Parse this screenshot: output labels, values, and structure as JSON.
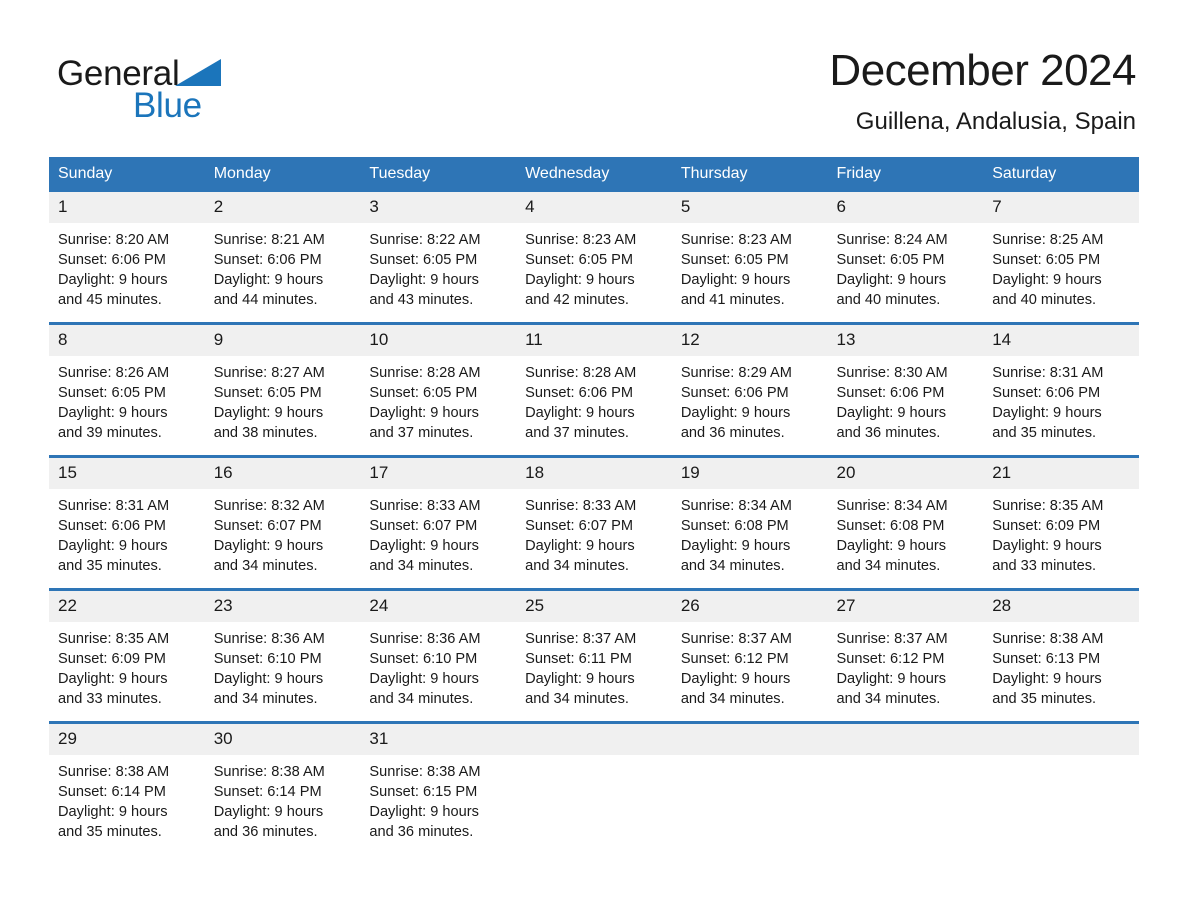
{
  "brand": {
    "name_part1": "General",
    "name_part2": "Blue",
    "triangle_color": "#1b75bb",
    "text_color": "#1a1a1a"
  },
  "header": {
    "title": "December 2024",
    "subtitle": "Guillena, Andalusia, Spain"
  },
  "theme": {
    "header_blue": "#2e75b6",
    "row_divider_blue": "#2e75b6",
    "daynum_band": "#f0f0f0",
    "page_background": "#ffffff"
  },
  "calendar": {
    "month": "December",
    "year": "2024",
    "location": "Guillena, Andalusia, Spain",
    "weekday_headers": [
      "Sunday",
      "Monday",
      "Tuesday",
      "Wednesday",
      "Thursday",
      "Friday",
      "Saturday"
    ],
    "weeks": [
      [
        {
          "day": "1",
          "sunrise": "Sunrise: 8:20 AM",
          "sunset": "Sunset: 6:06 PM",
          "daylight_line1": "Daylight: 9 hours",
          "daylight_line2": "and 45 minutes."
        },
        {
          "day": "2",
          "sunrise": "Sunrise: 8:21 AM",
          "sunset": "Sunset: 6:06 PM",
          "daylight_line1": "Daylight: 9 hours",
          "daylight_line2": "and 44 minutes."
        },
        {
          "day": "3",
          "sunrise": "Sunrise: 8:22 AM",
          "sunset": "Sunset: 6:05 PM",
          "daylight_line1": "Daylight: 9 hours",
          "daylight_line2": "and 43 minutes."
        },
        {
          "day": "4",
          "sunrise": "Sunrise: 8:23 AM",
          "sunset": "Sunset: 6:05 PM",
          "daylight_line1": "Daylight: 9 hours",
          "daylight_line2": "and 42 minutes."
        },
        {
          "day": "5",
          "sunrise": "Sunrise: 8:23 AM",
          "sunset": "Sunset: 6:05 PM",
          "daylight_line1": "Daylight: 9 hours",
          "daylight_line2": "and 41 minutes."
        },
        {
          "day": "6",
          "sunrise": "Sunrise: 8:24 AM",
          "sunset": "Sunset: 6:05 PM",
          "daylight_line1": "Daylight: 9 hours",
          "daylight_line2": "and 40 minutes."
        },
        {
          "day": "7",
          "sunrise": "Sunrise: 8:25 AM",
          "sunset": "Sunset: 6:05 PM",
          "daylight_line1": "Daylight: 9 hours",
          "daylight_line2": "and 40 minutes."
        }
      ],
      [
        {
          "day": "8",
          "sunrise": "Sunrise: 8:26 AM",
          "sunset": "Sunset: 6:05 PM",
          "daylight_line1": "Daylight: 9 hours",
          "daylight_line2": "and 39 minutes."
        },
        {
          "day": "9",
          "sunrise": "Sunrise: 8:27 AM",
          "sunset": "Sunset: 6:05 PM",
          "daylight_line1": "Daylight: 9 hours",
          "daylight_line2": "and 38 minutes."
        },
        {
          "day": "10",
          "sunrise": "Sunrise: 8:28 AM",
          "sunset": "Sunset: 6:05 PM",
          "daylight_line1": "Daylight: 9 hours",
          "daylight_line2": "and 37 minutes."
        },
        {
          "day": "11",
          "sunrise": "Sunrise: 8:28 AM",
          "sunset": "Sunset: 6:06 PM",
          "daylight_line1": "Daylight: 9 hours",
          "daylight_line2": "and 37 minutes."
        },
        {
          "day": "12",
          "sunrise": "Sunrise: 8:29 AM",
          "sunset": "Sunset: 6:06 PM",
          "daylight_line1": "Daylight: 9 hours",
          "daylight_line2": "and 36 minutes."
        },
        {
          "day": "13",
          "sunrise": "Sunrise: 8:30 AM",
          "sunset": "Sunset: 6:06 PM",
          "daylight_line1": "Daylight: 9 hours",
          "daylight_line2": "and 36 minutes."
        },
        {
          "day": "14",
          "sunrise": "Sunrise: 8:31 AM",
          "sunset": "Sunset: 6:06 PM",
          "daylight_line1": "Daylight: 9 hours",
          "daylight_line2": "and 35 minutes."
        }
      ],
      [
        {
          "day": "15",
          "sunrise": "Sunrise: 8:31 AM",
          "sunset": "Sunset: 6:06 PM",
          "daylight_line1": "Daylight: 9 hours",
          "daylight_line2": "and 35 minutes."
        },
        {
          "day": "16",
          "sunrise": "Sunrise: 8:32 AM",
          "sunset": "Sunset: 6:07 PM",
          "daylight_line1": "Daylight: 9 hours",
          "daylight_line2": "and 34 minutes."
        },
        {
          "day": "17",
          "sunrise": "Sunrise: 8:33 AM",
          "sunset": "Sunset: 6:07 PM",
          "daylight_line1": "Daylight: 9 hours",
          "daylight_line2": "and 34 minutes."
        },
        {
          "day": "18",
          "sunrise": "Sunrise: 8:33 AM",
          "sunset": "Sunset: 6:07 PM",
          "daylight_line1": "Daylight: 9 hours",
          "daylight_line2": "and 34 minutes."
        },
        {
          "day": "19",
          "sunrise": "Sunrise: 8:34 AM",
          "sunset": "Sunset: 6:08 PM",
          "daylight_line1": "Daylight: 9 hours",
          "daylight_line2": "and 34 minutes."
        },
        {
          "day": "20",
          "sunrise": "Sunrise: 8:34 AM",
          "sunset": "Sunset: 6:08 PM",
          "daylight_line1": "Daylight: 9 hours",
          "daylight_line2": "and 34 minutes."
        },
        {
          "day": "21",
          "sunrise": "Sunrise: 8:35 AM",
          "sunset": "Sunset: 6:09 PM",
          "daylight_line1": "Daylight: 9 hours",
          "daylight_line2": "and 33 minutes."
        }
      ],
      [
        {
          "day": "22",
          "sunrise": "Sunrise: 8:35 AM",
          "sunset": "Sunset: 6:09 PM",
          "daylight_line1": "Daylight: 9 hours",
          "daylight_line2": "and 33 minutes."
        },
        {
          "day": "23",
          "sunrise": "Sunrise: 8:36 AM",
          "sunset": "Sunset: 6:10 PM",
          "daylight_line1": "Daylight: 9 hours",
          "daylight_line2": "and 34 minutes."
        },
        {
          "day": "24",
          "sunrise": "Sunrise: 8:36 AM",
          "sunset": "Sunset: 6:10 PM",
          "daylight_line1": "Daylight: 9 hours",
          "daylight_line2": "and 34 minutes."
        },
        {
          "day": "25",
          "sunrise": "Sunrise: 8:37 AM",
          "sunset": "Sunset: 6:11 PM",
          "daylight_line1": "Daylight: 9 hours",
          "daylight_line2": "and 34 minutes."
        },
        {
          "day": "26",
          "sunrise": "Sunrise: 8:37 AM",
          "sunset": "Sunset: 6:12 PM",
          "daylight_line1": "Daylight: 9 hours",
          "daylight_line2": "and 34 minutes."
        },
        {
          "day": "27",
          "sunrise": "Sunrise: 8:37 AM",
          "sunset": "Sunset: 6:12 PM",
          "daylight_line1": "Daylight: 9 hours",
          "daylight_line2": "and 34 minutes."
        },
        {
          "day": "28",
          "sunrise": "Sunrise: 8:38 AM",
          "sunset": "Sunset: 6:13 PM",
          "daylight_line1": "Daylight: 9 hours",
          "daylight_line2": "and 35 minutes."
        }
      ],
      [
        {
          "day": "29",
          "sunrise": "Sunrise: 8:38 AM",
          "sunset": "Sunset: 6:14 PM",
          "daylight_line1": "Daylight: 9 hours",
          "daylight_line2": "and 35 minutes."
        },
        {
          "day": "30",
          "sunrise": "Sunrise: 8:38 AM",
          "sunset": "Sunset: 6:14 PM",
          "daylight_line1": "Daylight: 9 hours",
          "daylight_line2": "and 36 minutes."
        },
        {
          "day": "31",
          "sunrise": "Sunrise: 8:38 AM",
          "sunset": "Sunset: 6:15 PM",
          "daylight_line1": "Daylight: 9 hours",
          "daylight_line2": "and 36 minutes."
        },
        {
          "day": "",
          "sunrise": "",
          "sunset": "",
          "daylight_line1": "",
          "daylight_line2": ""
        },
        {
          "day": "",
          "sunrise": "",
          "sunset": "",
          "daylight_line1": "",
          "daylight_line2": ""
        },
        {
          "day": "",
          "sunrise": "",
          "sunset": "",
          "daylight_line1": "",
          "daylight_line2": ""
        },
        {
          "day": "",
          "sunrise": "",
          "sunset": "",
          "daylight_line1": "",
          "daylight_line2": ""
        }
      ]
    ]
  }
}
